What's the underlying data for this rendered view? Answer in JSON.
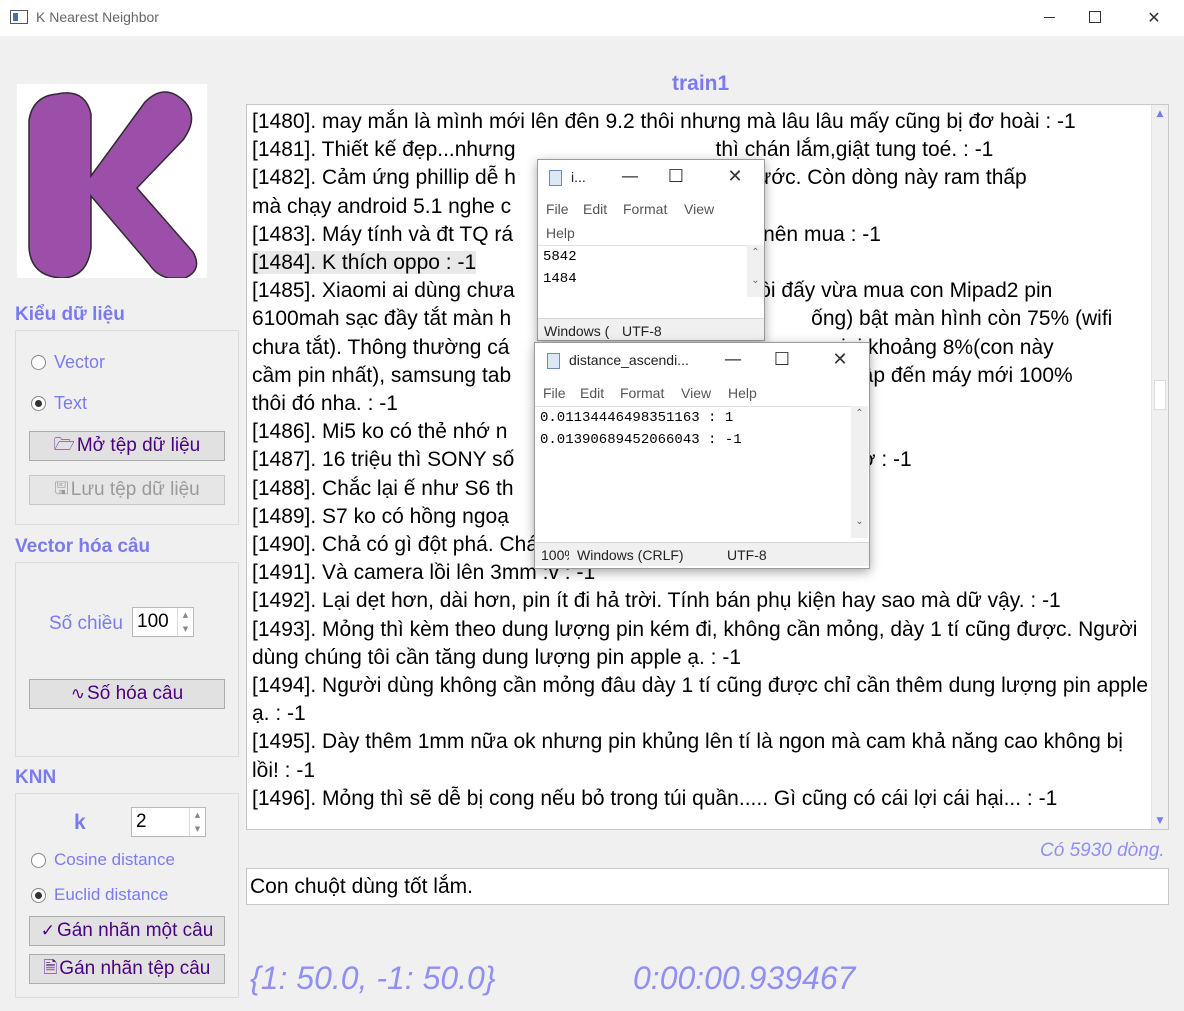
{
  "window": {
    "title": "K Nearest Neighbor",
    "min_label": "—",
    "close_label": "✕"
  },
  "logo": {
    "letter": "K",
    "color": "#9b4fa8"
  },
  "data_type": {
    "title": "Kiểu dữ liệu",
    "option_vector": "Vector",
    "option_text": "Text",
    "selected": "Text",
    "open_button": "Mở tệp dữ liệu",
    "save_button": "Lưu tệp dữ liệu"
  },
  "vectorize": {
    "title": "Vector hóa câu",
    "dimension_label": "Số chiều",
    "dimension_value": "100",
    "encode_button": "Số hóa câu"
  },
  "knn": {
    "title": "KNN",
    "k_label": "k",
    "k_value": "2",
    "option_cosine": "Cosine distance",
    "option_euclid": "Euclid distance",
    "selected": "Euclid distance",
    "label_one_button": "Gán nhãn một câu",
    "label_file_button": "Gán nhãn tệp câu"
  },
  "main": {
    "dataset_title": "train1",
    "lines": [
      "[1480]. may mắn là mình mới lên đên 9.2 thôi nhưng mà lâu lâu mấy cũng bị đơ hoài : -1",
      "[1481]. Thiết kế đẹp...nhưng",
      "thì chán lắm,giật tung toé. : -1",
      "[1482]. Cảm ứng phillip dễ h",
      "giọt nước. Còn dòng này ram thấp",
      "mà chạy android 5.1 nghe c",
      "[1483]. Máy tính và đt TQ rá",
      "nên mua : -1",
      "[1484]. K thích oppo : -1",
      "[1485]. Xiaomi ai dùng chưa",
      "n rồi đấy vừa mua con Mipad2 pin",
      "6100mah sạc đầy tắt màn h",
      "ống) bật màn hình còn 75% (wifi",
      "chưa tắt). Thông thường cá",
      "nini khoảng 8%(con này",
      "cầm pin nhất), samsung tab",
      "cập đến máy mới 100%",
      "thôi đó nha. : -1",
      "[1486]. Mi5 ko có thẻ nhớ n",
      "[1487]. 16 triệu thì SONY số",
      "n ợ : -1",
      "[1488]. Chắc lại ế như S6 th",
      "[1489]. S7 ko có hồng ngoạ",
      "[1490]. Chả có gì đột phá. Chán òm. : -1",
      "[1491]. Và camera lồi lên 3mm :v : -1",
      "[1492]. Lại dẹt hơn, dài hơn, pin ít đi hả trời. Tính bán phụ kiện hay sao mà dữ vậy. : -1",
      "[1493]. Mỏng thì kèm theo dung lượng pin kém đi, không cần mỏng, dày 1 tí cũng được. Người dùng chúng tôi cần tăng dung lượng pin apple ạ. : -1",
      "[1494]. Người dùng không cần mỏng đâu dày 1 tí cũng được chỉ cần thêm dung lượng pin apple ạ. : -1",
      "[1495]. Dày thêm 1mm nữa ok nhưng pin khủng lên tí là ngon mà cam khả năng cao không bị lồi! : -1",
      "[1496]. Mỏng thì sẽ dễ bị cong nếu bỏ trong túi quần..... Gì cũng có cái lợi cái hại... : -1"
    ],
    "line_count": "Có 5930 dòng.",
    "input_value": "Con chuột dùng tốt lắm.",
    "result_label": "{1: 50.0, -1: 50.0}",
    "elapsed_time": "0:00:00.939467"
  },
  "notepad1": {
    "title": "i...",
    "menu": [
      "File",
      "Edit",
      "Format",
      "View",
      "Help"
    ],
    "content": [
      "5842",
      "1484"
    ],
    "status_encoding": "Windows (",
    "status_charset": "UTF-8"
  },
  "notepad2": {
    "title": "distance_ascendi...",
    "menu": [
      "File",
      "Edit",
      "Format",
      "View",
      "Help"
    ],
    "content": [
      "0.01134446498351163 : 1",
      "0.01390689452066043 : -1"
    ],
    "status_zoom": "100%",
    "status_encoding": "Windows (CRLF)",
    "status_charset": "UTF-8"
  },
  "colors": {
    "accent": "#7b7bf0",
    "button_text": "#4b0082",
    "result": "#8f8ff5"
  }
}
